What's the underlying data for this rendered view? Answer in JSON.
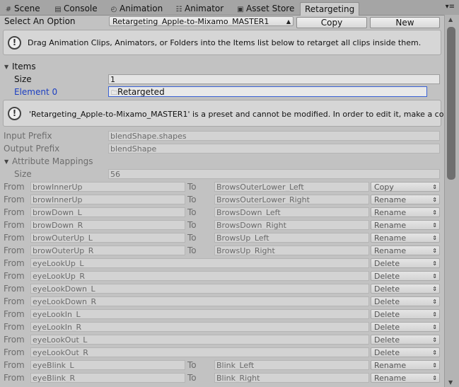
{
  "tabs": [
    {
      "label": "Scene",
      "icon": "scene-icon"
    },
    {
      "label": "Console",
      "icon": "console-icon"
    },
    {
      "label": "Animation",
      "icon": "animation-icon"
    },
    {
      "label": "Animator",
      "icon": "animator-icon"
    },
    {
      "label": "Asset Store",
      "icon": "asset-store-icon"
    },
    {
      "label": "Retargeting",
      "icon": ""
    }
  ],
  "active_tab": "Retargeting",
  "options": {
    "label": "Select An Option",
    "selected": "Retargeting_Apple-to-Mixamo_MASTER1",
    "copy_label": "Copy",
    "new_label": "New"
  },
  "help_drag": "Drag Animation Clips, Animators, or Folders into the Items list below to retarget all clips inside them.",
  "items": {
    "label": "Items",
    "size_label": "Size",
    "size_value": "1",
    "element_label": "Element 0",
    "element_value": "Retargeted"
  },
  "help_preset": "'Retargeting_Apple-to-Mixamo_MASTER1' is a preset and cannot be modified. In order to edit it, make a copy first.",
  "input_prefix": {
    "label": "Input Prefix",
    "value": "blendShape.shapes"
  },
  "output_prefix": {
    "label": "Output Prefix",
    "value": "blendShape"
  },
  "attribute_mappings": {
    "label": "Attribute Mappings",
    "size_label": "Size",
    "size_value": "56",
    "from_label": "From",
    "to_label": "To",
    "rows": [
      {
        "from": "browInnerUp",
        "to": "BrowsOuterLower_Left",
        "action": "Copy"
      },
      {
        "from": "browInnerUp",
        "to": "BrowsOuterLower_Right",
        "action": "Rename"
      },
      {
        "from": "browDown_L",
        "to": "BrowsDown_Left",
        "action": "Rename"
      },
      {
        "from": "browDown_R",
        "to": "BrowsDown_Right",
        "action": "Rename"
      },
      {
        "from": "browOuterUp_L",
        "to": "BrowsUp_Left",
        "action": "Rename"
      },
      {
        "from": "browOuterUp_R",
        "to": "BrowsUp_Right",
        "action": "Rename"
      },
      {
        "from": "eyeLookUp_L",
        "to": "",
        "action": "Delete"
      },
      {
        "from": "eyeLookUp_R",
        "to": "",
        "action": "Delete"
      },
      {
        "from": "eyeLookDown_L",
        "to": "",
        "action": "Delete"
      },
      {
        "from": "eyeLookDown_R",
        "to": "",
        "action": "Delete"
      },
      {
        "from": "eyeLookIn_L",
        "to": "",
        "action": "Delete"
      },
      {
        "from": "eyeLookIn_R",
        "to": "",
        "action": "Delete"
      },
      {
        "from": "eyeLookOut_L",
        "to": "",
        "action": "Delete"
      },
      {
        "from": "eyeLookOut_R",
        "to": "",
        "action": "Delete"
      },
      {
        "from": "eyeBlink_L",
        "to": "Blink_Left",
        "action": "Rename"
      },
      {
        "from": "eyeBlink_R",
        "to": "Blink_Right",
        "action": "Rename"
      }
    ]
  }
}
